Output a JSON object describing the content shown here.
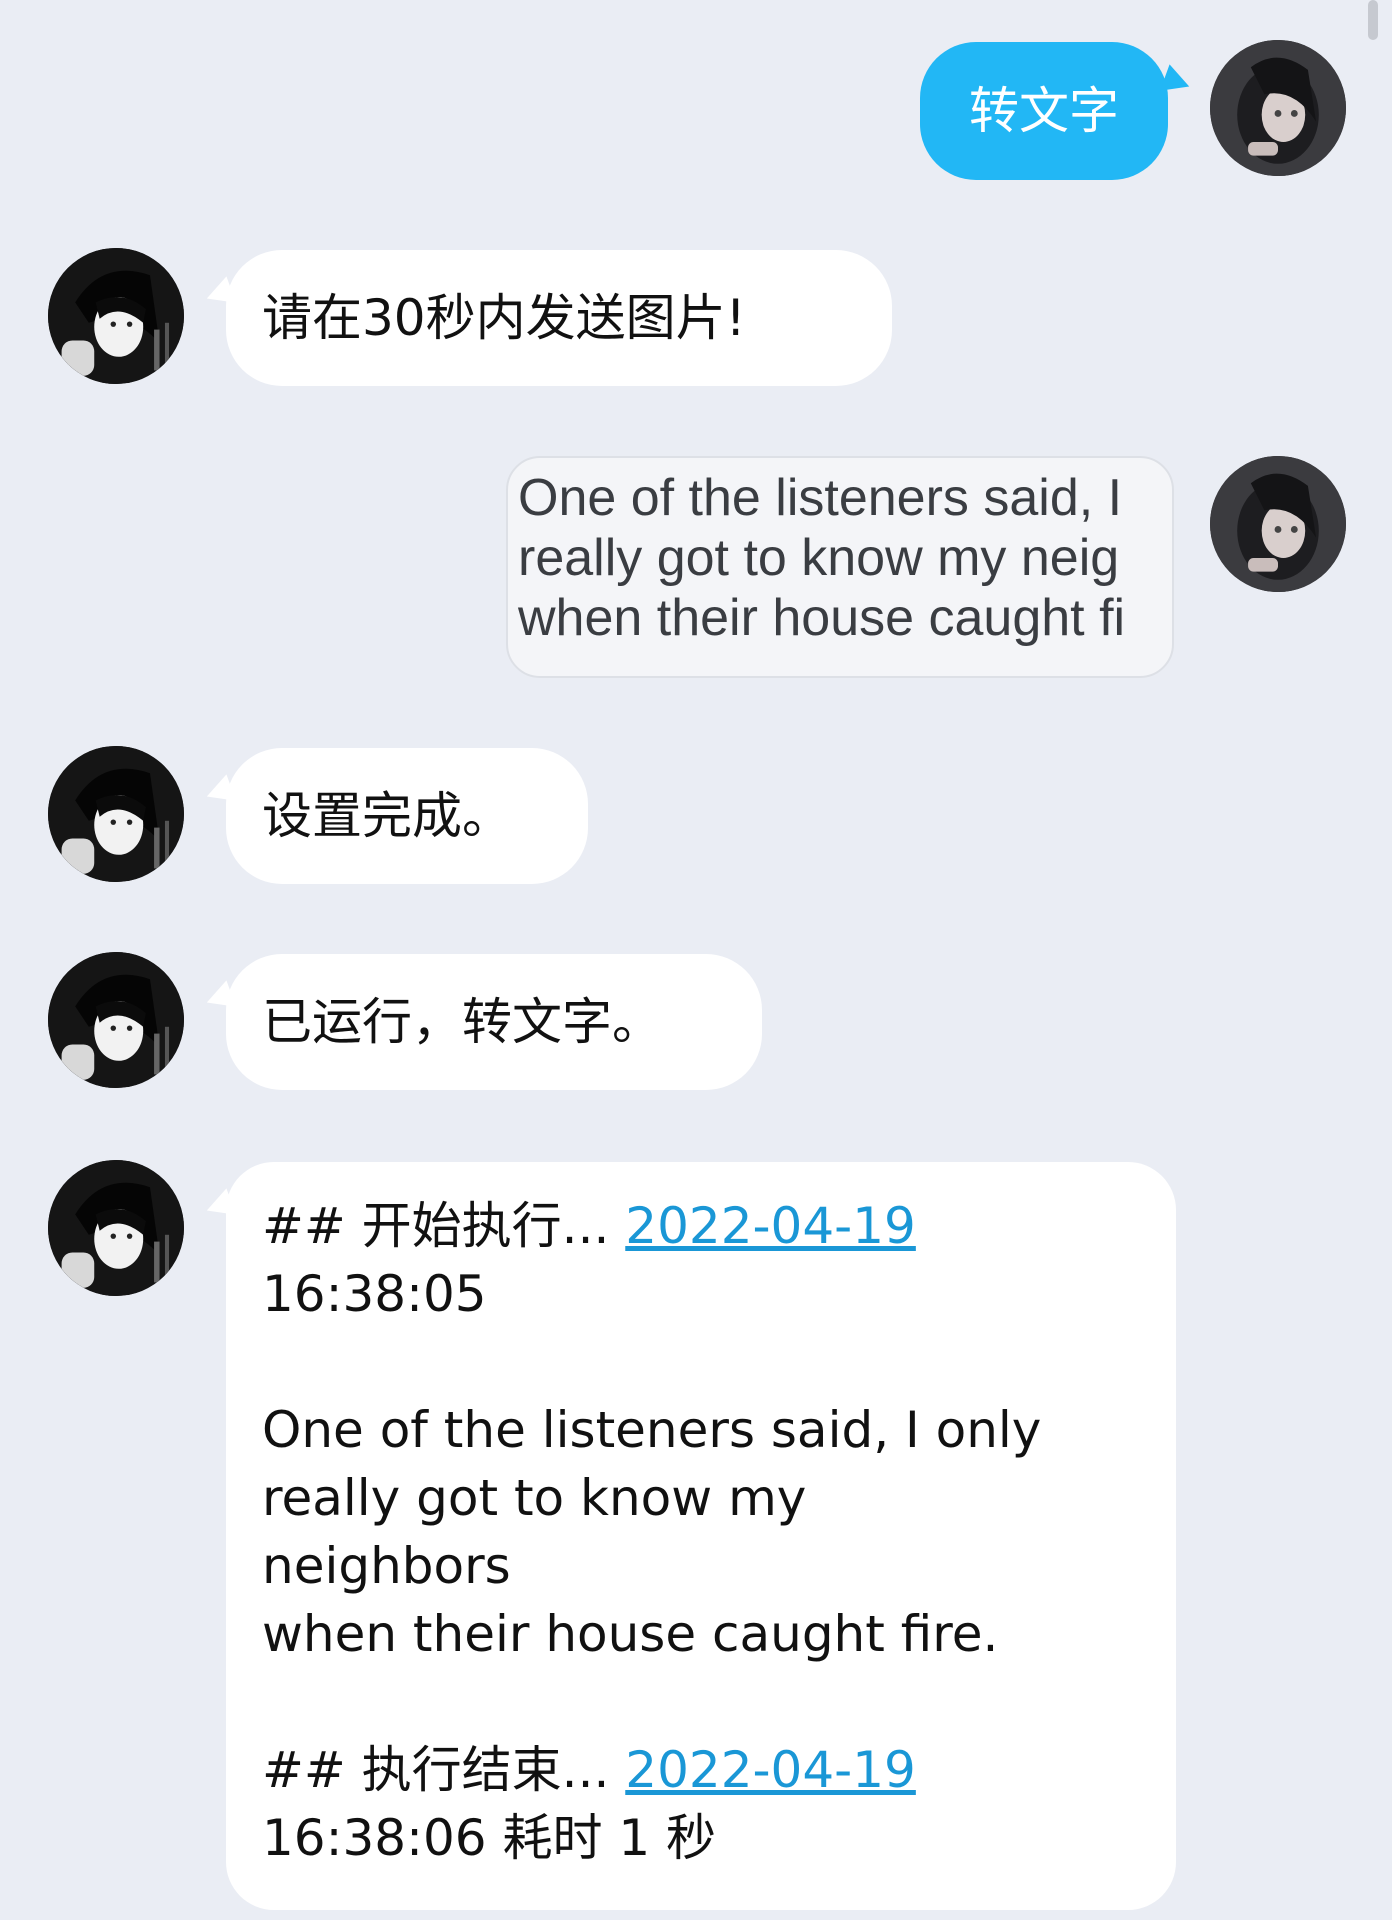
{
  "messages": [
    {
      "id": "m1",
      "side": "right",
      "text": "转文字"
    },
    {
      "id": "m2",
      "side": "left",
      "text": "请在30秒内发送图片!"
    },
    {
      "id": "m3",
      "side": "right",
      "type": "image",
      "lines": [
        "One of the listeners said, I",
        "really got to know my neig",
        "when their house caught fi"
      ]
    },
    {
      "id": "m4",
      "side": "left",
      "text": "设置完成。"
    },
    {
      "id": "m5",
      "side": "left",
      "text": "已运行，转文字。"
    },
    {
      "id": "m6",
      "side": "left",
      "type": "log",
      "start_prefix": "## 开始执行... ",
      "start_date": "2022-04-19",
      "start_time": "16:38:05",
      "body_lines": [
        "One of the listeners said, I only",
        "really got to know my",
        "neighbors",
        "when their house caught fire."
      ],
      "end_prefix": "## 执行结束... ",
      "end_date": "2022-04-19",
      "end_time_suffix": "16:38:06 耗时 1 秒"
    }
  ],
  "colors": {
    "background": "#eaedf4",
    "user_bubble": "#22b7f5",
    "bot_bubble": "#ffffff",
    "link": "#1a97d6"
  },
  "icons": {
    "user_avatar": "anime-girl-avatar-icon",
    "bot_avatar": "monochrome-anime-boy-avatar-icon"
  }
}
